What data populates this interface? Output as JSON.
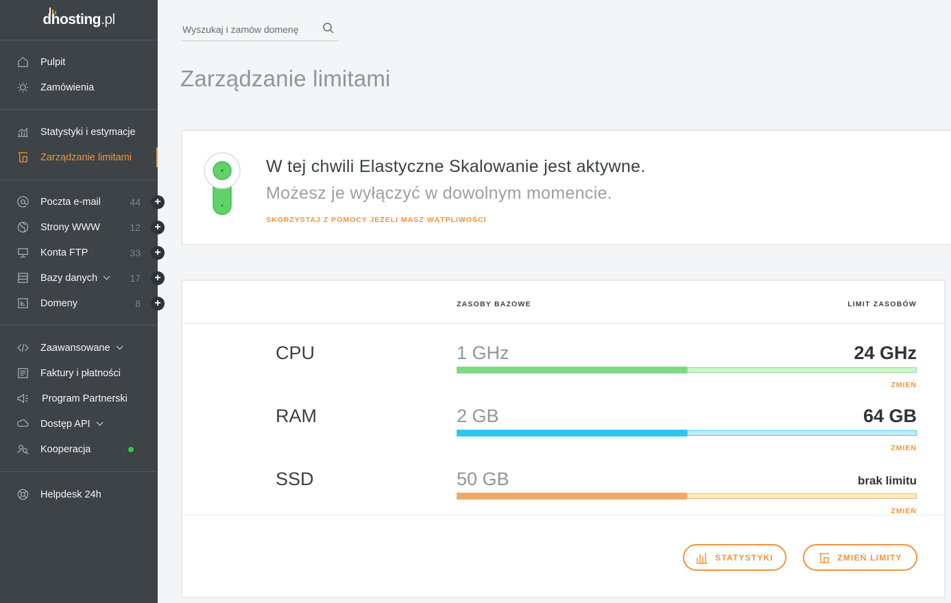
{
  "logo": {
    "brand": "dhosting",
    "tld": ".pl"
  },
  "search": {
    "placeholder": "Wyszukaj i zamów domenę"
  },
  "sidebar": {
    "groups": [
      [
        {
          "label": "Pulpit",
          "icon": "home-icon"
        },
        {
          "label": "Zamówienia",
          "icon": "bulb-icon"
        }
      ],
      [
        {
          "label": "Statystyki i estymacje",
          "icon": "chart-icon"
        },
        {
          "label": "Zarządzanie limitami",
          "icon": "limits-icon",
          "active": true
        }
      ],
      [
        {
          "label": "Poczta e-mail",
          "icon": "at-icon",
          "count": "44"
        },
        {
          "label": "Strony WWW",
          "icon": "globe-icon",
          "count": "12"
        },
        {
          "label": "Konta FTP",
          "icon": "monitor-icon",
          "count": "33"
        },
        {
          "label": "Bazy danych",
          "icon": "database-icon",
          "count": "17",
          "dropdown": true
        },
        {
          "label": "Domeny",
          "icon": "domain-icon",
          "count": "8"
        }
      ],
      [
        {
          "label": "Zaawansowane",
          "icon": "code-icon",
          "dropdown": true
        },
        {
          "label": "Faktury i płatności",
          "icon": "invoice-icon"
        },
        {
          "label": "Program Partnerski",
          "icon": "megaphone-icon"
        },
        {
          "label": "Dostęp API",
          "icon": "api-icon",
          "dropdown": true
        },
        {
          "label": "Kooperacja",
          "icon": "cooperation-icon",
          "online": true
        }
      ],
      [
        {
          "label": "Helpdesk 24h",
          "icon": "lifebuoy-icon"
        }
      ]
    ]
  },
  "page": {
    "title": "Zarządzanie limitami"
  },
  "info": {
    "heading": "W tej chwili Elastyczne Skalowanie jest aktywne.",
    "sub": "Możesz je wyłączyć w dowolnym momencie.",
    "help_link": "SKORZYSTAJ Z POMOCY JEŻELI MASZ WĄTPLIWOŚCI",
    "toggle_state": "on"
  },
  "resources": {
    "col_base": "ZASOBY BAZOWE",
    "col_limit": "LIMIT ZASOBÓW",
    "change_label": "ZMIEŃ",
    "rows": [
      {
        "name": "CPU",
        "base": "1 GHz",
        "limit": "24 GHz",
        "fill": 0.5,
        "color": "#7ddc83",
        "rest_color": "#c8f0c9"
      },
      {
        "name": "RAM",
        "base": "2 GB",
        "limit": "64 GB",
        "fill": 0.5,
        "color": "#2ec7ec",
        "rest_color": "#b6ebf7"
      },
      {
        "name": "SSD",
        "base": "50 GB",
        "limit": "brak limitu",
        "fill": 0.5,
        "color": "#f3a767",
        "rest_color": "#fbe7b8"
      }
    ]
  },
  "buttons": {
    "stats": "STATYSTYKI",
    "change_limits": "ZMIEŃ LIMITY"
  },
  "colors": {
    "accent": "#f2933a",
    "sidebar": "#3d4347",
    "active_green": "#4ad25a"
  }
}
